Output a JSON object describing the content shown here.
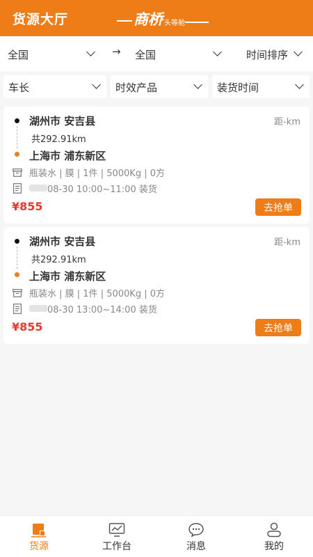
{
  "header": {
    "title": "货源大厅",
    "logo_main": "商桥",
    "logo_sub": "头等舱"
  },
  "filters": {
    "from": "全国",
    "arrow": "→",
    "to": "全国",
    "sort": "时间排序",
    "vehicle_length": "车长",
    "product": "时效产品",
    "load_time": "装货时间"
  },
  "cards": [
    {
      "from": "湖州市 安吉县",
      "distance": "距-km",
      "total": "共292.91km",
      "to": "上海市 浦东新区",
      "goods": "瓶装水 | 膜 | 1件 | 5000Kg | 0方",
      "time": "08-30 10:00~11:00  装货",
      "price": "¥855",
      "button": "去抢单"
    },
    {
      "from": "湖州市 安吉县",
      "distance": "距-km",
      "total": "共292.91km",
      "to": "上海市 浦东新区",
      "goods": "瓶装水 | 膜 | 1件 | 5000Kg | 0方",
      "time": "08-30 13:00~14:00  装货",
      "price": "¥855",
      "button": "去抢单"
    }
  ],
  "tabs": [
    {
      "label": "货源",
      "icon": "cargo-icon"
    },
    {
      "label": "工作台",
      "icon": "workbench-icon"
    },
    {
      "label": "消息",
      "icon": "message-icon"
    },
    {
      "label": "我的",
      "icon": "profile-icon"
    }
  ],
  "colors": {
    "accent": "#ee7d18",
    "price": "#e23b2a",
    "background": "#f6f6f6"
  }
}
